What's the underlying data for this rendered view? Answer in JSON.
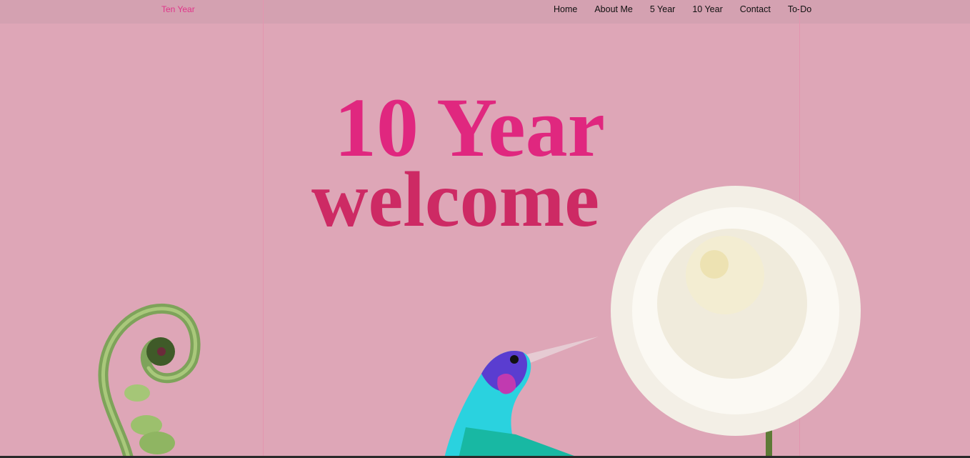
{
  "nav": {
    "brand": "Ten Year",
    "links": [
      "Home",
      "About Me",
      "5 Year",
      "10 Year",
      "Contact",
      "To-Do"
    ]
  },
  "hero": {
    "title": "10 Year",
    "subtitle": "welcome"
  },
  "colors": {
    "background": "#dea6b7",
    "navbar": "#d4a1b1",
    "brand": "#e0358a",
    "title": "#e0277f",
    "subtitle": "#cd2a64"
  }
}
